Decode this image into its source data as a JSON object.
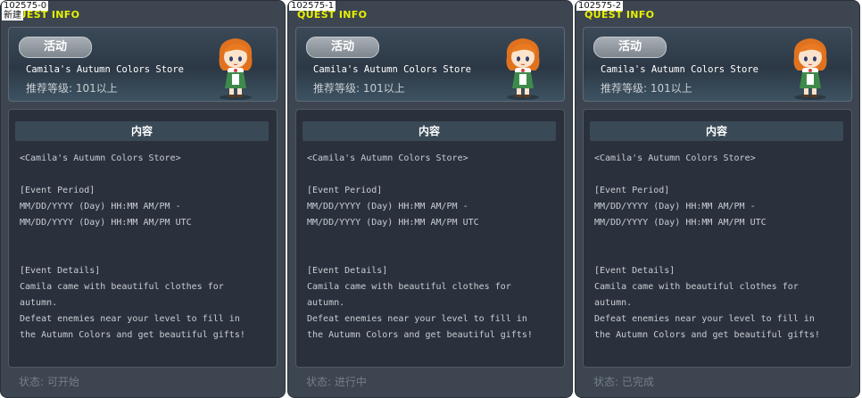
{
  "overlay_label": "新建",
  "panels": [
    {
      "id": "102575-0",
      "header": "QUEST INFO",
      "badge": "活动",
      "store_name": "Camila's Autumn Colors Store",
      "recommended_level": "推荐等级: 101以上",
      "content_header": "内容",
      "content": {
        "title_line": "<Camila's Autumn Colors Store>",
        "period_label": "[Event Period]",
        "period_line1": "MM/DD/YYYY (Day) HH:MM AM/PM -",
        "period_line2": "MM/DD/YYYY (Day) HH:MM AM/PM UTC",
        "details_label": "[Event Details]",
        "details_line1": "Camila came with beautiful clothes for",
        "details_line2": "autumn.",
        "details_line3": "Defeat enemies near your level to fill in",
        "details_line4": "the Autumn Colors and get beautiful gifts!"
      },
      "status": "状态: 可开始"
    },
    {
      "id": "102575-1",
      "header": "QUEST INFO",
      "badge": "活动",
      "store_name": "Camila's Autumn Colors Store",
      "recommended_level": "推荐等级: 101以上",
      "content_header": "内容",
      "content": {
        "title_line": "<Camila's Autumn Colors Store>",
        "period_label": "[Event Period]",
        "period_line1": "MM/DD/YYYY (Day) HH:MM AM/PM -",
        "period_line2": "MM/DD/YYYY (Day) HH:MM AM/PM UTC",
        "details_label": "[Event Details]",
        "details_line1": "Camila came with beautiful clothes for",
        "details_line2": "autumn.",
        "details_line3": "Defeat enemies near your level to fill in",
        "details_line4": "the Autumn Colors and get beautiful gifts!"
      },
      "status": "状态: 进行中"
    },
    {
      "id": "102575-2",
      "header": "QUEST INFO",
      "badge": "活动",
      "store_name": "Camila's Autumn Colors Store",
      "recommended_level": "推荐等级: 101以上",
      "content_header": "内容",
      "content": {
        "title_line": "<Camila's Autumn Colors Store>",
        "period_label": "[Event Period]",
        "period_line1": "MM/DD/YYYY (Day) HH:MM AM/PM -",
        "period_line2": "MM/DD/YYYY (Day) HH:MM AM/PM UTC",
        "details_label": "[Event Details]",
        "details_line1": "Camila came with beautiful clothes for",
        "details_line2": "autumn.",
        "details_line3": "Defeat enemies near your level to fill in",
        "details_line4": "the Autumn Colors and get beautiful gifts!"
      },
      "status": "状态: 已完成"
    }
  ],
  "colors": {
    "header_yellow": "#e8f000",
    "panel_bg": "#3c4550",
    "content_bg": "#2a313c",
    "status_gray": "#767e87"
  },
  "icons": [
    "npc-camila-icon"
  ]
}
